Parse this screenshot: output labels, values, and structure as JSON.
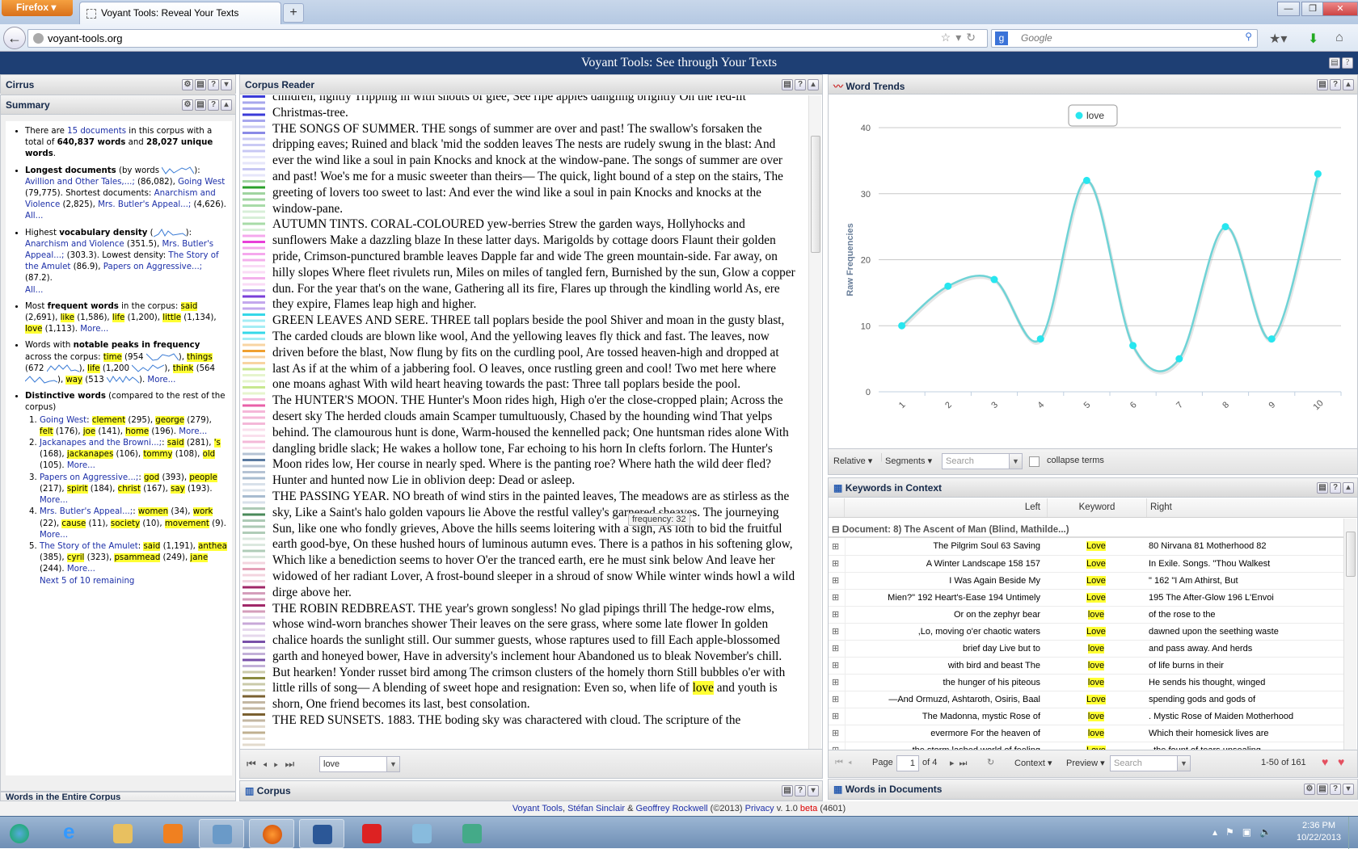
{
  "browser": {
    "menu_button": "Firefox",
    "tab_title": "Voyant Tools: Reveal Your Texts",
    "new_tab": "+",
    "url": "voyant-tools.org",
    "search_placeholder": "Google"
  },
  "app": {
    "title": "Voyant Tools: See through Your Texts"
  },
  "cirrus": {
    "title": "Cirrus"
  },
  "summary": {
    "title": "Summary",
    "intro": {
      "pre": "There are ",
      "docs_link": "15 documents",
      "mid": " in this corpus with a total of ",
      "words": "640,837 words",
      "and": " and ",
      "unique": "28,027 unique words",
      "end": "."
    },
    "longest": {
      "label": "Longest documents",
      "by": " (by words ",
      "close": "):",
      "doc1": "Avillion and Other Tales,...;",
      "doc1_count": " (86,082), ",
      "doc2": "Going West",
      "doc2_count": " (79,775). Shortest documents: ",
      "doc3": "Anarchism and Violence",
      "doc3_count": " (2,825), ",
      "doc4": "Mrs. Butler's Appeal...;",
      "doc4_count": " (4,626).",
      "all": "All..."
    },
    "density": {
      "pre": "Highest ",
      "label": "vocabulary density",
      "open": " (",
      "close": "):",
      "doc1": "Anarchism and Violence",
      "doc1_val": " (351.5), ",
      "doc2": "Mrs. Butler's Appeal...;",
      "doc2_val": " (303.3). Lowest density: ",
      "doc3": "The Story of the Amulet",
      "doc3_val": " (86.9), ",
      "doc4": "Papers on Aggressive...;",
      "doc4_val": " (87.2).",
      "all": "All..."
    },
    "frequent": {
      "pre": "Most ",
      "label": "frequent words",
      "mid": " in the corpus: ",
      "words": [
        {
          "w": "said",
          "c": " (2,691), "
        },
        {
          "w": "like",
          "c": " (1,586), "
        },
        {
          "w": "life",
          "c": " (1,200), "
        },
        {
          "w": "little",
          "c": " (1,134), "
        },
        {
          "w": "love",
          "c": " (1,113). "
        }
      ],
      "more": "More..."
    },
    "peaks": {
      "pre": "Words with ",
      "label": "notable peaks in frequency",
      "mid": " across the corpus: ",
      "words": [
        {
          "w": "time",
          "c": " (954 "
        },
        {
          "w": "things",
          "c": " (672 "
        },
        {
          "w": "life",
          "c": " (1,200 "
        },
        {
          "w": "think",
          "c": " (564 "
        },
        {
          "w": "way",
          "c": " (513 "
        }
      ],
      "more": "More..."
    },
    "distinctive": {
      "label": "Distinctive words",
      "note": " (compared to the rest of the corpus)",
      "items": [
        {
          "doc": "Going West",
          "words": [
            [
              "clement",
              " (295), "
            ],
            [
              "george",
              " (279), "
            ],
            [
              "felt",
              " (176), "
            ],
            [
              "joe",
              " (141), "
            ],
            [
              "home",
              " (196). "
            ]
          ]
        },
        {
          "doc": "Jackanapes and the Browni...;",
          "words": [
            [
              "said",
              " (281), "
            ],
            [
              "'s",
              " (168), "
            ],
            [
              "jackanapes",
              " (106), "
            ],
            [
              "tommy",
              " (108), "
            ],
            [
              "old",
              " (105). "
            ]
          ]
        },
        {
          "doc": "Papers on Aggressive...;",
          "words": [
            [
              "god",
              " (393), "
            ],
            [
              "people",
              " (217), "
            ],
            [
              "spirit",
              " (184), "
            ],
            [
              "christ",
              " (167), "
            ],
            [
              "say",
              " (193). "
            ]
          ]
        },
        {
          "doc": "Mrs. Butler's Appeal...;",
          "words": [
            [
              "women",
              " (34), "
            ],
            [
              "work",
              " (22), "
            ],
            [
              "cause",
              " (11), "
            ],
            [
              "society",
              " (10), "
            ],
            [
              "movement",
              " (9). "
            ]
          ]
        },
        {
          "doc": "The Story of the Amulet",
          "words": [
            [
              "said",
              " (1,191), "
            ],
            [
              "anthea",
              " (385), "
            ],
            [
              "cyril",
              " (323), "
            ],
            [
              "psammead",
              " (249), "
            ],
            [
              "jane",
              " (244). "
            ]
          ]
        }
      ],
      "more": "More...",
      "next": "Next 5 of 10 remaining"
    }
  },
  "words_in_corpus": {
    "title": "Words in the Entire Corpus"
  },
  "reader": {
    "title": "Corpus Reader",
    "partial_top": "children, lightly Tripping in with shouts of glee, See ripe apples dangling brightly On the red-lit",
    "paragraphs": [
      "Christmas-tree.",
      "THE SONGS OF SUMMER. THE songs of summer are over and past! The swallow's forsaken the dripping eaves; Ruined and black 'mid the sodden leaves The nests are rudely swung in the blast: And ever the wind like a soul in pain Knocks and knock at the window-pane. The songs of summer are over and past! Woe's me for a music sweeter than theirs— The quick, light bound of a step on the stairs, The greeting of lovers too sweet to last: And ever the wind like a soul in pain Knocks and knocks at the window-pane.",
      "AUTUMN TINTS. CORAL-COLOURED yew-berries Strew the garden ways, Hollyhocks and sunflowers Make a dazzling blaze In these latter days. Marigolds by cottage doors Flaunt their golden pride, Crimson-punctured bramble leaves Dapple far and wide The green mountain-side. Far away, on hilly slopes Where fleet rivulets run, Miles on miles of tangled fern, Burnished by the sun, Glow a copper dun. For the year that's on the wane, Gathering all its fire, Flares up through the kindling world As, ere they expire, Flames leap high and higher.",
      "GREEN LEAVES AND SERE. THREE tall poplars beside the pool Shiver and moan in the gusty blast, The carded clouds are blown like wool, And the yellowing leaves fly thick and fast. The leaves, now driven before the blast, Now flung by fits on the curdling pool, Are tossed heaven-high and dropped at last As if at the whim of a jabbering fool. O leaves, once rustling green and cool! Two met here where one moans aghast With wild heart heaving towards the past: Three tall poplars beside the pool.",
      "The HUNTER'S MOON. THE Hunter's Moon rides high, High o'er the close-cropped plain; Across the desert sky The herded clouds amain Scamper tumultuously, Chased by the hounding wind That yelps behind. The clamourous hunt is done, Warm-housed the kennelled pack; One huntsman rides alone With dangling bridle slack; He wakes a hollow tone, Far echoing to his horn In clefts forlorn. The Hunter's Moon rides low, Her course in nearly sped. Where is the panting roe? Where hath the wild deer fled? Hunter and hunted now Lie in oblivion deep: Dead or asleep.",
      "THE PASSING YEAR. NO breath of wind stirs in the painted leaves, The meadows are as stirless as the sky, Like a Saint's halo golden vapours lie Above the restful valley's garnered sheaves. The journeying Sun, like one who fondly grieves, Above the hills seems loitering with a sigh, As loth to bid the fruitful earth good-bye, On these hushed hours of luminous autumn eves. There is a pathos in his softening glow, Which like a benediction seems to hover O'er the tranced earth, ere he must sink below And leave her widowed of her radiant Lover, A frost-bound sleeper in a shroud of snow While winter winds howl a wild dirge above her."
    ],
    "robin_pre": "THE ROBIN REDBREAST. THE year's grown songless! No glad pipings thrill The hedge-row elms, whose wind-worn branches shower Their leaves on the sere grass, where some late flower In golden chalice hoards the sunlight still. Our summer guests, whose raptures used to fill Each apple-blossomed garth and honeyed bower, Have in adversity's inclement hour Abandoned us to bleak November's chill. But hearken! Yonder russet bird among The crimson clusters of the homely thorn Still bubbles o'er with little rills of song— A blending of sweet hope and resignation: Even so, when life of ",
    "robin_kw": "love",
    "robin_post": " and youth is shorn, One friend becomes its last, best consolation.",
    "partial_bottom": "THE RED SUNSETS. 1883. THE boding sky was charactered with cloud. The scripture of the",
    "tooltip": "frequency: 32",
    "term_value": "love"
  },
  "corpus_panel": {
    "title": "Corpus"
  },
  "word_trends": {
    "title": "Word Trends",
    "toolbar": {
      "relative": "Relative",
      "segments": "Segments",
      "search_placeholder": "Search",
      "collapse": "collapse terms"
    }
  },
  "chart_data": {
    "type": "line",
    "title": "",
    "xlabel": "",
    "ylabel": "Raw Frequencies",
    "categories": [
      "1",
      "2",
      "3",
      "4",
      "5",
      "6",
      "7",
      "8",
      "9",
      "10"
    ],
    "series": [
      {
        "name": "love",
        "color": "#27e6ef",
        "values": [
          10,
          16,
          17,
          8,
          32,
          7,
          5,
          25,
          8,
          33
        ]
      }
    ],
    "ylim": [
      0,
      40
    ],
    "yticks": [
      0,
      10,
      20,
      30,
      40
    ],
    "grid": true,
    "legend": "top-center",
    "smooth": true
  },
  "kwic": {
    "title": "Keywords in Context",
    "columns": [
      "Left",
      "Keyword",
      "Right"
    ],
    "group": "Document: 8) The Ascent of Man (Blind, Mathilde...)",
    "rows": [
      {
        "left": "The Pilgrim Soul 63 Saving",
        "kw": "Love",
        "right": "80 Nirvana 81 Motherhood 82"
      },
      {
        "left": "A Winter Landscape 158 157",
        "kw": "Love",
        "right": "In Exile. Songs. \"Thou Walkest"
      },
      {
        "left": "I Was Again Beside My",
        "kw": "Love",
        "right": "\" 162 \"I Am Athirst, But"
      },
      {
        "left": "Mien?\" 192 Heart's-Ease 194 Untimely",
        "kw": "Love",
        "right": "195 The After-Glow 196 L'Envoi"
      },
      {
        "left": "Or on the zephyr bear",
        "kw": "love",
        "right": "of the rose to the"
      },
      {
        "left": ",Lo, moving o'er chaotic waters",
        "kw": "Love",
        "right": "dawned upon the seething waste"
      },
      {
        "left": "brief day Live but to",
        "kw": "love",
        "right": "and pass away. And herds"
      },
      {
        "left": "with bird and beast The",
        "kw": "love",
        "right": "of life burns in their"
      },
      {
        "left": "the hunger of his piteous",
        "kw": "love",
        "right": "He sends his thought, winged"
      },
      {
        "left": "—And Ormuzd, Ashtaroth, Osiris, Baal",
        "kw": "Love",
        "right": "spending gods and gods of"
      },
      {
        "left": "The Madonna, mystic Rose of",
        "kw": "love",
        "right": ". Mystic Rose of Maiden Motherhood"
      },
      {
        "left": "evermore For the heaven of",
        "kw": "love",
        "right": "Which their homesick lives are"
      },
      {
        "left": "the storm lashed world of feeling",
        "kw": "Love",
        "right": ", the fount of tears unsealing"
      }
    ],
    "pager": {
      "page_label": "Page",
      "page_value": "1",
      "of": "of 4",
      "context": "Context",
      "preview": "Preview",
      "search_placeholder": "Search",
      "count": "1-50 of 161"
    }
  },
  "words_in_documents": {
    "title": "Words in Documents"
  },
  "footer": {
    "voyant": "Voyant Tools",
    "sep1": ", ",
    "sinclair": "Stéfan Sinclair",
    "amp": " & ",
    "rockwell": "Geoffrey Rockwell",
    "copy": " (©2013) ",
    "privacy": "Privacy",
    "version": " v. 1.0 ",
    "beta": "beta",
    "build": " (4601)"
  },
  "taskbar": {
    "time": "2:36 PM",
    "date": "10/22/2013"
  }
}
